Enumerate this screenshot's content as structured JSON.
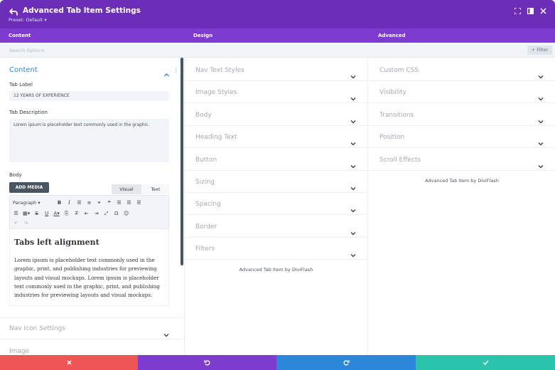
{
  "header": {
    "title": "Advanced Tab Item Settings",
    "preset": "Preset: Default ▾"
  },
  "tabs": [
    {
      "label": "Content"
    },
    {
      "label": "Design"
    },
    {
      "label": "Advanced"
    }
  ],
  "search": {
    "placeholder": "Search Options",
    "filter_label": "+ Filter"
  },
  "content": {
    "section_title": "Content",
    "tab_label_label": "Tab Label",
    "tab_label_value": "12 YEARS OF EXPERIENCE",
    "tab_desc_label": "Tab Description",
    "tab_desc_value": "Lorem ipsum is placeholder text commonly used in the graphic.",
    "body_label": "Body",
    "add_media": "ADD MEDIA",
    "visual_tab": "Visual",
    "text_tab": "Text",
    "format_select": "Paragraph",
    "editor_heading": "Tabs left alignment",
    "editor_paragraph": "Lorem ipsum is placeholder text commonly used in the graphic, print, and publishing industries for previewing layouts and visual mockups. Lorem ipsum is placeholder text commonly used in the graphic, print, and publishing industries for previewing layouts and visual mockups.",
    "sections": [
      {
        "label": "Nav Icon Settings"
      },
      {
        "label": "Image"
      }
    ]
  },
  "design": {
    "sections": [
      {
        "label": "Nav Text Styles"
      },
      {
        "label": "Image Styles"
      },
      {
        "label": "Body"
      },
      {
        "label": "Heading Text"
      },
      {
        "label": "Button"
      },
      {
        "label": "Sizing"
      },
      {
        "label": "Spacing"
      },
      {
        "label": "Border"
      },
      {
        "label": "Filters"
      }
    ],
    "footer": "Advanced Tab Item by DiviFlash"
  },
  "advanced": {
    "sections": [
      {
        "label": "Custom CSS"
      },
      {
        "label": "Visibility"
      },
      {
        "label": "Transitions"
      },
      {
        "label": "Position"
      },
      {
        "label": "Scroll Effects"
      }
    ],
    "footer": "Advanced Tab Item by DiviFlash"
  },
  "colors": {
    "header": "#6c2eb9",
    "tabs": "#7e3bd0",
    "accent": "#2b87da",
    "cancel": "#ef5555",
    "undo": "#7e3bd0",
    "redo": "#2b87da",
    "save": "#29c4a9"
  }
}
